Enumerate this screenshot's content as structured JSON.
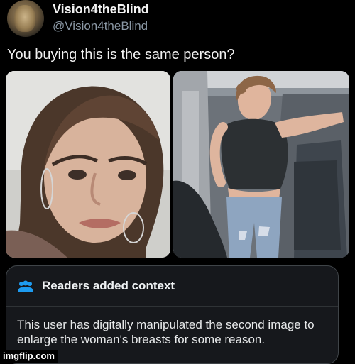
{
  "tweet": {
    "display_name": "Vision4theBlind",
    "handle": "@Vision4theBlind",
    "text": "You buying this is the same person?"
  },
  "media": {
    "left_image": "portrait-photo",
    "right_image": "airplane-aisle-photo"
  },
  "community_note": {
    "title": "Readers added context",
    "icon": "people-icon",
    "accent_color": "#1d9bf0",
    "body": "This user has digitally manipulated the second image to enlarge the woman's breasts for some reason."
  },
  "watermark": "imgflip.com"
}
